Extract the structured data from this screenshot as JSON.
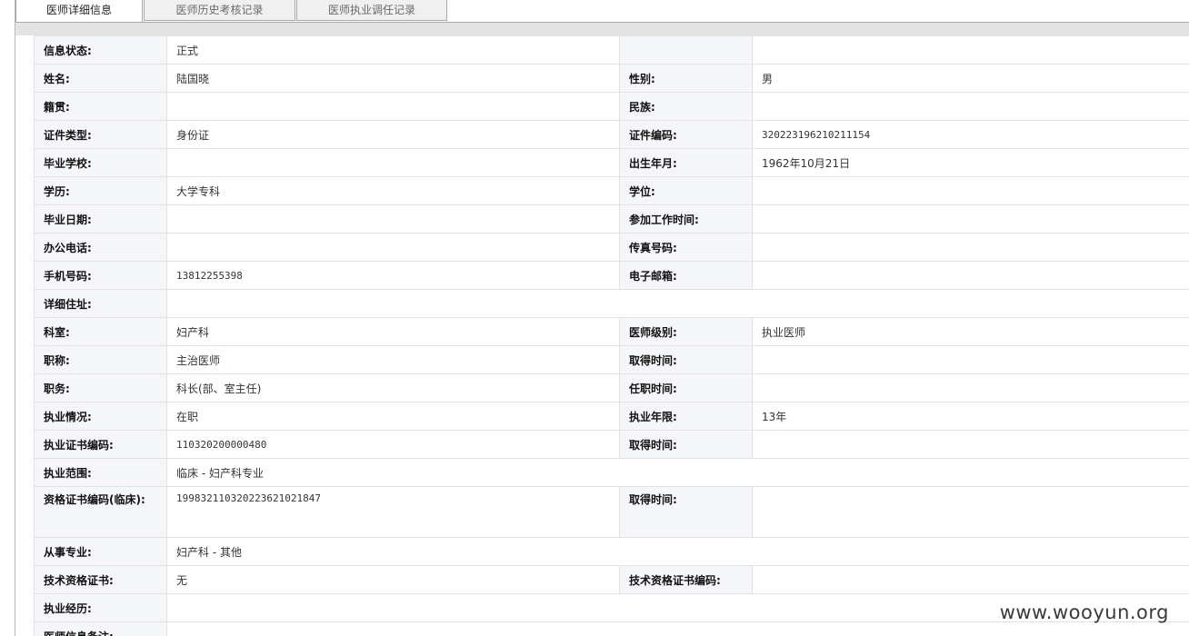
{
  "tabs": [
    {
      "label": "医师详细信息"
    },
    {
      "label": "医师历史考核记录"
    },
    {
      "label": "医师执业调任记录"
    }
  ],
  "fields": {
    "status": {
      "label": "信息状态:",
      "value": "正式"
    },
    "name": {
      "label": "姓名:",
      "value": "陆国晓"
    },
    "gender": {
      "label": "性别:",
      "value": "男"
    },
    "native_place": {
      "label": "籍贯:",
      "value": ""
    },
    "ethnicity": {
      "label": "民族:",
      "value": ""
    },
    "id_type": {
      "label": "证件类型:",
      "value": "身份证"
    },
    "id_number": {
      "label": "证件编码:",
      "value": "320223196210211154"
    },
    "school": {
      "label": "毕业学校:",
      "value": ""
    },
    "birth": {
      "label": "出生年月:",
      "value": "1962年10月21日"
    },
    "education": {
      "label": "学历:",
      "value": "大学专科"
    },
    "degree": {
      "label": "学位:",
      "value": ""
    },
    "grad_date": {
      "label": "毕业日期:",
      "value": ""
    },
    "work_start": {
      "label": "参加工作时间:",
      "value": ""
    },
    "office_phone": {
      "label": "办公电话:",
      "value": ""
    },
    "fax": {
      "label": "传真号码:",
      "value": ""
    },
    "mobile": {
      "label": "手机号码:",
      "value": "13812255398"
    },
    "email": {
      "label": "电子邮箱:",
      "value": ""
    },
    "address": {
      "label": "详细住址:",
      "value": ""
    },
    "department": {
      "label": "科室:",
      "value": "妇产科"
    },
    "doctor_level": {
      "label": "医师级别:",
      "value": "执业医师"
    },
    "title": {
      "label": "职称:",
      "value": "主治医师"
    },
    "title_date": {
      "label": "取得时间:",
      "value": ""
    },
    "position": {
      "label": "职务:",
      "value": "科长(部、室主任)"
    },
    "position_date": {
      "label": "任职时间:",
      "value": ""
    },
    "practice_status": {
      "label": "执业情况:",
      "value": "在职"
    },
    "practice_years": {
      "label": "执业年限:",
      "value": "13年"
    },
    "practice_cert": {
      "label": "执业证书编码:",
      "value": "110320200000480"
    },
    "practice_cert_date": {
      "label": "取得时间:",
      "value": ""
    },
    "practice_scope": {
      "label": "执业范围:",
      "value": "临床 - 妇产科专业"
    },
    "qual_cert": {
      "label": "资格证书编码(临床):",
      "value": "199832110320223621021847"
    },
    "qual_cert_date": {
      "label": "取得时间:",
      "value": ""
    },
    "specialty": {
      "label": "从事专业:",
      "value": "妇产科 - 其他"
    },
    "tech_cert": {
      "label": "技术资格证书:",
      "value": "无"
    },
    "tech_cert_no": {
      "label": "技术资格证书编码:",
      "value": ""
    },
    "experience": {
      "label": "执业经历:",
      "value": ""
    },
    "remarks": {
      "label": "医师信息备注:",
      "value": ""
    }
  },
  "watermark": "www.wooyun.org"
}
